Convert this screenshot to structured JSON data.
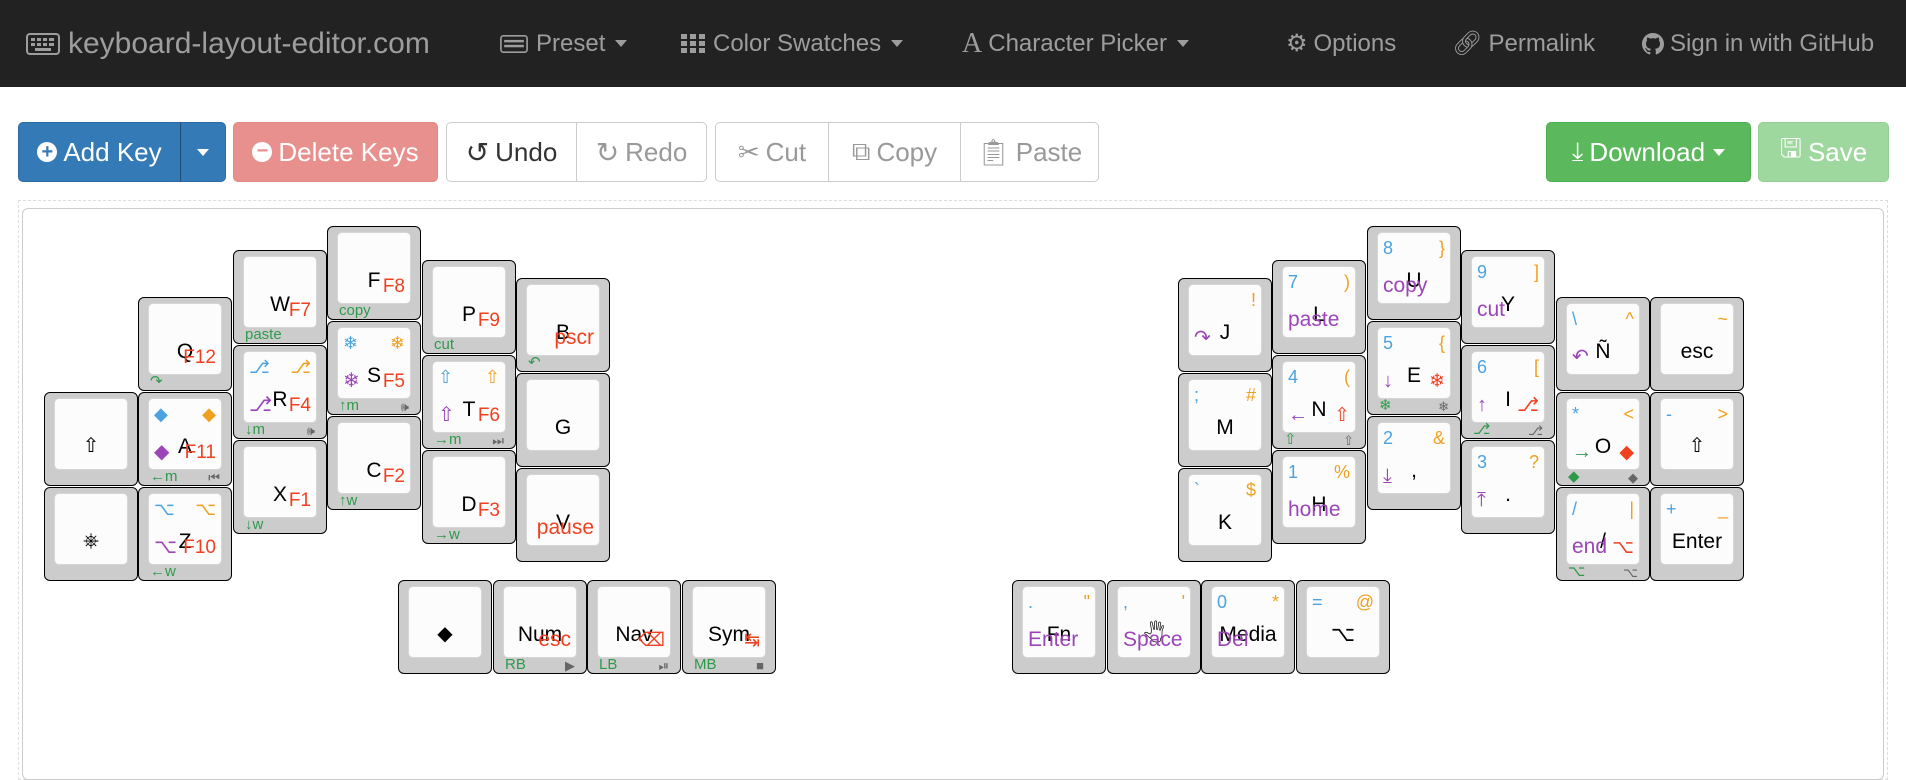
{
  "navbar": {
    "brand": "keyboard-layout-editor.com",
    "preset": "Preset",
    "color_swatches": "Color Swatches",
    "character_picker": "Character Picker",
    "options": "Options",
    "permalink": "Permalink",
    "signin": "Sign in with GitHub"
  },
  "toolbar": {
    "add_key": "Add Key",
    "delete_keys": "Delete Keys",
    "undo": "Undo",
    "redo": "Redo",
    "cut": "Cut",
    "copy": "Copy",
    "paste": "Paste",
    "download": "Download",
    "save": "Save"
  },
  "colors": {
    "blue": "#4aa3e0",
    "orange": "#f0a020",
    "purple": "#9b45b8",
    "red": "#f04020",
    "green": "#2f9a4c",
    "gray": "#777777",
    "key_bg": "#cccccc",
    "navbar_bg": "#222222"
  },
  "keys": [
    {
      "id": "shift-left",
      "main": "⇧"
    },
    {
      "id": "star-left",
      "main": "⎈"
    },
    {
      "id": "q",
      "main": "Q",
      "br": "F12",
      "fl": "↷"
    },
    {
      "id": "a",
      "main": "A",
      "tl": "◆",
      "tr": "◆",
      "bl": "◆",
      "br": "F11",
      "fl": "←m",
      "fr": "⏮"
    },
    {
      "id": "z",
      "main": "Z",
      "tl": "⌥",
      "tr": "⌥",
      "bl": "⌥",
      "br": "F10",
      "fl": "←w"
    },
    {
      "id": "w",
      "main": "W",
      "br": "F7",
      "fl": "paste"
    },
    {
      "id": "r",
      "main": "R",
      "tl": "⎇",
      "tr": "⎇",
      "bl": "⎇",
      "br": "F4",
      "fl": "↓m",
      "fr": "🕪"
    },
    {
      "id": "x",
      "main": "X",
      "br": "F1",
      "fl": "↓w"
    },
    {
      "id": "f",
      "main": "F",
      "br": "F8",
      "fl": "copy"
    },
    {
      "id": "s",
      "main": "S",
      "tl": "❄",
      "tr": "❄",
      "bl": "❄",
      "br": "F5",
      "fl": "↑m",
      "fr": "🕪"
    },
    {
      "id": "c",
      "main": "C",
      "br": "F2",
      "fl": "↑w"
    },
    {
      "id": "p",
      "main": "P",
      "br": "F9",
      "fl": "cut"
    },
    {
      "id": "t",
      "main": "T",
      "tl": "⇧",
      "tr": "⇧",
      "bl": "⇧",
      "br": "F6",
      "fl": "→m",
      "fr": "⏭"
    },
    {
      "id": "d",
      "main": "D",
      "br": "F3",
      "fl": "→w"
    },
    {
      "id": "b",
      "main": "B",
      "br": "pscr",
      "fl": "↶"
    },
    {
      "id": "g",
      "main": "G"
    },
    {
      "id": "v",
      "main": "V",
      "br": "pause"
    },
    {
      "id": "diamond",
      "main": "◆"
    },
    {
      "id": "num",
      "main": "Num",
      "br": "esc",
      "fl": "RB",
      "fr": "▶"
    },
    {
      "id": "nav",
      "main": "Nav",
      "br": "⌫",
      "fl": "LB",
      "fr": "⏯"
    },
    {
      "id": "sym",
      "main": "Sym",
      "br": "↹",
      "fl": "MB",
      "fr": "■"
    },
    {
      "id": "j",
      "main": "J",
      "tr": "!",
      "bl": "↷"
    },
    {
      "id": "m",
      "main": "M",
      "tl": ";",
      "tr": "#"
    },
    {
      "id": "k",
      "main": "K",
      "tl": "`",
      "tr": "$"
    },
    {
      "id": "l",
      "main": "L",
      "tl": "7",
      "tr": ")",
      "bl": "paste"
    },
    {
      "id": "n",
      "main": "N",
      "tl": "4",
      "tr": "(",
      "bl": "←",
      "br": "⇧",
      "fl": "⇧",
      "fr": "⇧"
    },
    {
      "id": "h",
      "main": "H",
      "tl": "1",
      "tr": "%",
      "bl": "home"
    },
    {
      "id": "u",
      "main": "U",
      "tl": "8",
      "tr": "}",
      "bl": "copy"
    },
    {
      "id": "e",
      "main": "E",
      "tl": "5",
      "tr": "{",
      "bl": "↓",
      "br": "❄",
      "fl": "❄",
      "fr": "❄"
    },
    {
      "id": "comma",
      "main": ",",
      "tl": "2",
      "tr": "&",
      "bl": "⤓"
    },
    {
      "id": "y",
      "main": "Y",
      "tl": "9",
      "tr": "]",
      "bl": "cut"
    },
    {
      "id": "i",
      "main": "I",
      "tl": "6",
      "tr": "[",
      "bl": "↑",
      "br": "⎇",
      "fl": "⎇",
      "fr": "⎇"
    },
    {
      "id": "dot",
      "main": ".",
      "tl": "3",
      "tr": "?",
      "bl": "⤒"
    },
    {
      "id": "ntilde",
      "main": "Ñ",
      "tl": "\\",
      "tr": "^",
      "bl": "↶"
    },
    {
      "id": "o",
      "main": "O",
      "tl": "*",
      "tr": "<",
      "bl": "→",
      "br": "◆",
      "fl": "◆",
      "fr": "◆"
    },
    {
      "id": "slash",
      "main": "/",
      "tl": "/",
      "tr": "|",
      "bl": "end",
      "br": "⌥",
      "fl": "⌥",
      "fr": "⌥"
    },
    {
      "id": "esc",
      "main": "esc",
      "tr": "~"
    },
    {
      "id": "shift-right",
      "main": "⇧",
      "tl": "-",
      "tr": ">"
    },
    {
      "id": "enter",
      "main": "Enter",
      "tl": "+",
      "tr": "_"
    },
    {
      "id": "fn",
      "main": "Fn",
      "tl": ".",
      "tr": "\"",
      "bl": "Enter"
    },
    {
      "id": "space",
      "main": "🖑",
      "tl": ",",
      "tr": "'",
      "bl": "Space"
    },
    {
      "id": "media",
      "main": "Media",
      "tl": "0",
      "tr": "*",
      "bl": "Del"
    },
    {
      "id": "alt-right",
      "main": "⌥",
      "tl": "=",
      "tr": "@"
    }
  ]
}
